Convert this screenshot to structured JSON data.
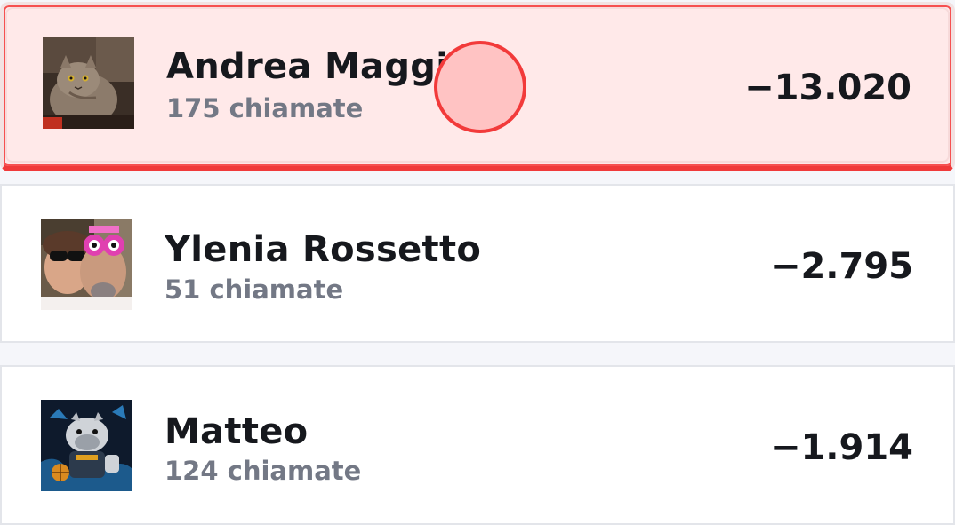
{
  "leaderboard": {
    "rows": [
      {
        "name": "Andrea Maggi",
        "calls": "175 chiamate",
        "amount": "−13.020",
        "avatar_icon": "cat-photo-avatar",
        "highlighted": true
      },
      {
        "name": "Ylenia Rossetto",
        "calls": "51 chiamate",
        "amount": "−2.795",
        "avatar_icon": "couple-selfie-avatar",
        "highlighted": false
      },
      {
        "name": "Matteo",
        "calls": "124 chiamate",
        "amount": "−1.914",
        "avatar_icon": "bulldog-basketball-avatar",
        "highlighted": false
      }
    ]
  },
  "colors": {
    "highlight_bg": "#ffe8e8",
    "highlight_border": "#f03a3a",
    "tap_marker_fill": "#ffc3c3",
    "text_primary": "#16181d",
    "text_secondary": "#737885"
  }
}
